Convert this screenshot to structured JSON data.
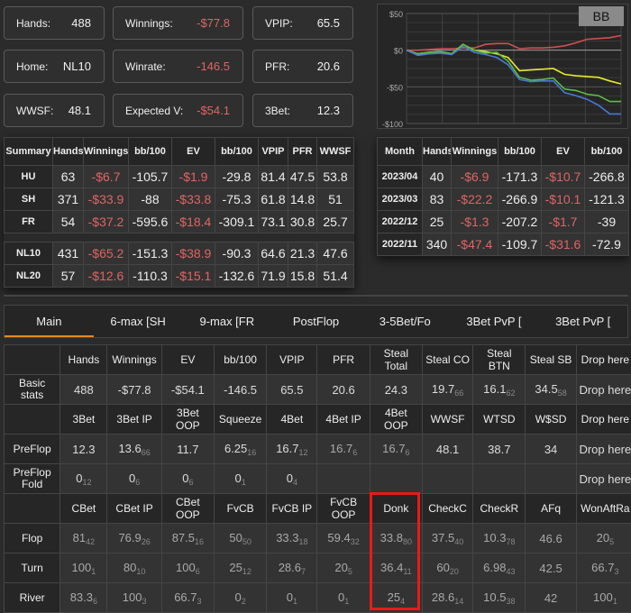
{
  "cards": [
    {
      "label": "Hands:",
      "value": "488"
    },
    {
      "label": "Winnings:",
      "value": "-$77.8",
      "neg": true
    },
    {
      "label": "VPIP:",
      "value": "65.5"
    },
    {
      "label": "Home:",
      "value": "NL10"
    },
    {
      "label": "Winrate:",
      "value": "-146.5",
      "neg": true
    },
    {
      "label": "PFR:",
      "value": "20.6"
    },
    {
      "label": "WWSF:",
      "value": "48.1"
    },
    {
      "label": "Expected V:",
      "value": "-$54.1",
      "neg": true
    },
    {
      "label": "3Bet:",
      "value": "12.3"
    }
  ],
  "chart_data": {
    "type": "line",
    "toggle_label": "BB",
    "ylim": [
      -100,
      50
    ],
    "yticks": [
      "$50",
      "$0",
      "-$50",
      "-$100"
    ],
    "ytick_values": [
      50,
      0,
      -50,
      -100
    ],
    "series": [
      {
        "name": "red",
        "color": "#d05050",
        "values": [
          0,
          0,
          1,
          2,
          2,
          3,
          3,
          8,
          9,
          9,
          2,
          3,
          3,
          4,
          6,
          10,
          15,
          16,
          17,
          20
        ]
      },
      {
        "name": "yellow",
        "color": "#e8e830",
        "values": [
          0,
          -5,
          -3,
          -2,
          -5,
          8,
          0,
          -2,
          -5,
          -10,
          -28,
          -27,
          -26,
          -25,
          -33,
          -35,
          -36,
          -37,
          -42,
          -46
        ]
      },
      {
        "name": "green",
        "color": "#5cc040",
        "values": [
          0,
          -5,
          -3,
          -2,
          -5,
          8,
          0,
          -4,
          -3,
          -15,
          -37,
          -41,
          -40,
          -38,
          -53,
          -55,
          -60,
          -62,
          -70,
          -70
        ]
      },
      {
        "name": "blue",
        "color": "#4a78d8",
        "values": [
          0,
          -7,
          -5,
          -4,
          -6,
          5,
          -3,
          -6,
          -10,
          -20,
          -40,
          -43,
          -42,
          -42,
          -58,
          -62,
          -67,
          -75,
          -87,
          -87
        ]
      }
    ]
  },
  "summary": {
    "headers": [
      "Summary",
      "Hands",
      "Winnings",
      "bb/100",
      "EV",
      "bb/100",
      "VPIP",
      "PFR",
      "WWSF"
    ],
    "rows": [
      [
        "HU",
        "63",
        "-$6.7",
        "-105.7",
        "-$1.9",
        "-29.8",
        "81.4",
        "47.5",
        "53.8"
      ],
      [
        "SH",
        "371",
        "-$33.9",
        "-88",
        "-$33.8",
        "-75.3",
        "61.8",
        "14.8",
        "51"
      ],
      [
        "FR",
        "54",
        "-$37.2",
        "-595.6",
        "-$18.4",
        "-309.1",
        "73.1",
        "30.8",
        "25.7"
      ],
      null,
      [
        "NL10",
        "431",
        "-$65.2",
        "-151.3",
        "-$38.9",
        "-90.3",
        "64.6",
        "21.3",
        "47.6"
      ],
      [
        "NL20",
        "57",
        "-$12.6",
        "-110.3",
        "-$15.1",
        "-132.6",
        "71.9",
        "15.8",
        "51.4"
      ]
    ]
  },
  "months": {
    "headers": [
      "Month",
      "Hands",
      "Winnings",
      "bb/100",
      "EV",
      "bb/100"
    ],
    "rows": [
      [
        "2023/04",
        "40",
        "-$6.9",
        "-171.3",
        "-$10.7",
        "-266.8"
      ],
      [
        "2023/03",
        "83",
        "-$22.2",
        "-266.9",
        "-$10.1",
        "-121.3"
      ],
      [
        "2022/12",
        "25",
        "-$1.3",
        "-207.2",
        "-$1.7",
        "-39"
      ],
      [
        "2022/11",
        "340",
        "-$47.4",
        "-109.7",
        "-$31.6",
        "-72.9"
      ]
    ]
  },
  "tabs": [
    "Main",
    "6-max [SH",
    "9-max [FR",
    "PostFlop",
    "3-5Bet/Fo",
    "3Bet PvP [",
    "3Bet PvP ["
  ],
  "main": {
    "rows": [
      {
        "h": true,
        "cells": [
          "",
          "Hands",
          "Winnings",
          "EV",
          "bb/100",
          "VPIP",
          "PFR",
          "Steal Total",
          "Steal CO",
          "Steal BTN",
          "Steal SB",
          "Drop here"
        ]
      },
      {
        "cells": [
          "Basic stats",
          "488",
          "-$77.8",
          "-$54.1",
          "-146.5",
          "65.5",
          "20.6",
          "24.3",
          [
            "19.7",
            "66"
          ],
          [
            "16.1",
            "62"
          ],
          [
            "34.5",
            "58"
          ],
          "Drop here"
        ]
      },
      {
        "h": true,
        "cells": [
          "",
          "3Bet",
          "3Bet IP",
          "3Bet OOP",
          "Squeeze",
          "4Bet",
          "4Bet IP",
          "4Bet OOP",
          "WWSF",
          "WTSD",
          "W$SD",
          "Drop here"
        ]
      },
      {
        "cells": [
          "PreFlop",
          "12.3",
          [
            "13.6",
            "66"
          ],
          "11.7",
          [
            "6.25",
            "16"
          ],
          [
            "16.7",
            "12"
          ],
          [
            "16.7",
            "6"
          ],
          [
            "16.7",
            "6"
          ],
          "48.1",
          "38.7",
          "34",
          "Drop here"
        ]
      },
      {
        "cells": [
          "PreFlop Fold",
          [
            "0",
            "12"
          ],
          [
            "0",
            "6"
          ],
          [
            "0",
            "6"
          ],
          [
            "0",
            "1"
          ],
          [
            "0",
            "4"
          ],
          "",
          "",
          "",
          "",
          "",
          "Drop here"
        ]
      },
      {
        "h": true,
        "cells": [
          "",
          "CBet",
          "CBet IP",
          "CBet OOP",
          "FvCB",
          "FvCB IP",
          "FvCB OOP",
          "Donk",
          "CheckC",
          "CheckR",
          "AFq",
          "WonAftRa"
        ]
      },
      {
        "dim": true,
        "cells": [
          "Flop",
          [
            "81",
            "42"
          ],
          [
            "76.9",
            "26"
          ],
          [
            "87.5",
            "16"
          ],
          [
            "50",
            "50"
          ],
          [
            "33.3",
            "18"
          ],
          [
            "59.4",
            "32"
          ],
          [
            "33.8",
            "80"
          ],
          [
            "37.5",
            "40"
          ],
          [
            "10.3",
            "78"
          ],
          "46.6",
          [
            "20",
            "5"
          ]
        ]
      },
      {
        "dim": true,
        "cells": [
          "Turn",
          [
            "100",
            "1"
          ],
          [
            "80",
            "10"
          ],
          [
            "100",
            "6"
          ],
          [
            "25",
            "12"
          ],
          [
            "28.6",
            "7"
          ],
          [
            "20",
            "5"
          ],
          [
            "36.4",
            "11"
          ],
          [
            "60",
            "20"
          ],
          [
            "6.98",
            "43"
          ],
          "42.5",
          [
            "66.7",
            "3"
          ]
        ]
      },
      {
        "dim": true,
        "cells": [
          "River",
          [
            "83.3",
            "6"
          ],
          [
            "100",
            "3"
          ],
          [
            "66.7",
            "3"
          ],
          [
            "0",
            "2"
          ],
          [
            "0",
            "1"
          ],
          [
            "0",
            "1"
          ],
          [
            "25",
            "4"
          ],
          [
            "28.6",
            "14"
          ],
          [
            "10.5",
            "38"
          ],
          "42",
          [
            "100",
            "1"
          ]
        ]
      }
    ]
  }
}
